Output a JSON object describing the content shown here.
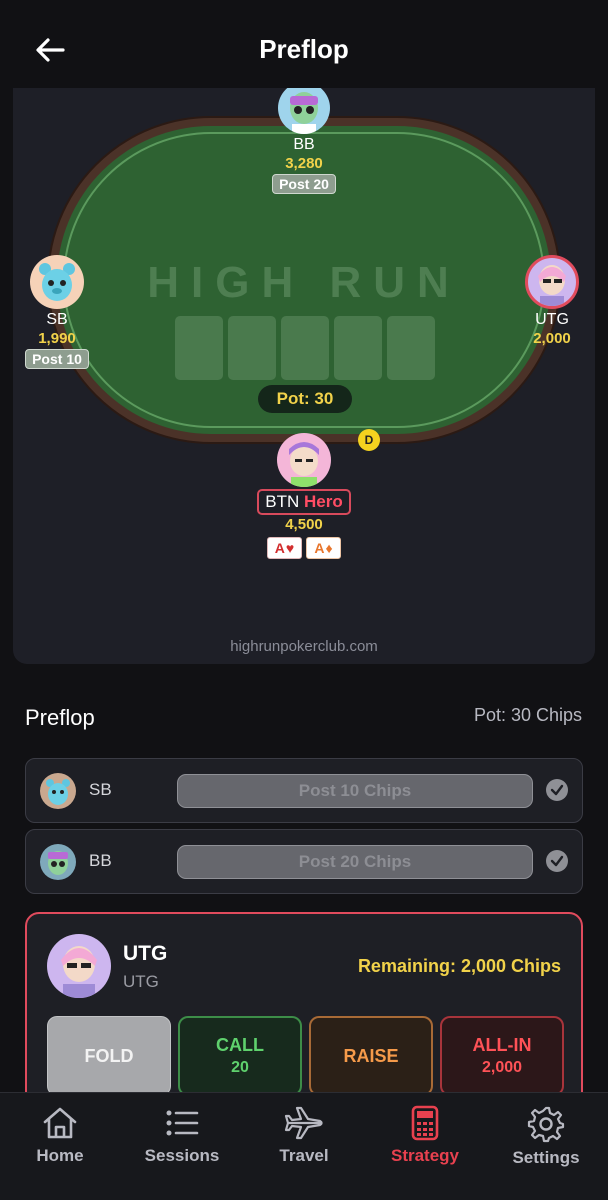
{
  "header": {
    "title": "Preflop"
  },
  "table": {
    "logo_text": "HIGH RUN",
    "pot_label": "Pot: 30",
    "dealer_label": "D",
    "watermark": "highrunpokerclub.com",
    "seats": {
      "bb": {
        "name": "BB",
        "stack": "3,280",
        "post": "Post 20"
      },
      "sb": {
        "name": "SB",
        "stack": "1,990",
        "post": "Post 10"
      },
      "utg": {
        "name": "UTG",
        "stack": "2,000"
      },
      "btn": {
        "name": "BTN",
        "hero_tag": "Hero",
        "stack": "4,500",
        "cards": [
          {
            "rank": "A",
            "suit": "♥"
          },
          {
            "rank": "A",
            "suit": "♦"
          }
        ]
      }
    }
  },
  "section": {
    "title": "Preflop",
    "pot": "Pot: 30 Chips"
  },
  "actions": [
    {
      "player": "SB",
      "action": "Post 10 Chips"
    },
    {
      "player": "BB",
      "action": "Post 20 Chips"
    }
  ],
  "active": {
    "name": "UTG",
    "position": "UTG",
    "remaining": "Remaining: 2,000 Chips",
    "buttons": {
      "fold": {
        "label": "FOLD"
      },
      "call": {
        "label": "CALL",
        "amount": "20"
      },
      "raise": {
        "label": "RAISE"
      },
      "allin": {
        "label": "ALL-IN",
        "amount": "2,000"
      }
    }
  },
  "tabs": [
    {
      "label": "Home",
      "icon": "home-icon"
    },
    {
      "label": "Sessions",
      "icon": "list-icon"
    },
    {
      "label": "Travel",
      "icon": "airplane-icon"
    },
    {
      "label": "Strategy",
      "icon": "calculator-icon",
      "active": true
    },
    {
      "label": "Settings",
      "icon": "gear-icon"
    }
  ],
  "colors": {
    "accent": "#e14b5d",
    "chips": "#f1d24a",
    "felt": "#2e6232",
    "tab_active": "#e8414f",
    "tab_inactive": "#b8b9c2"
  }
}
